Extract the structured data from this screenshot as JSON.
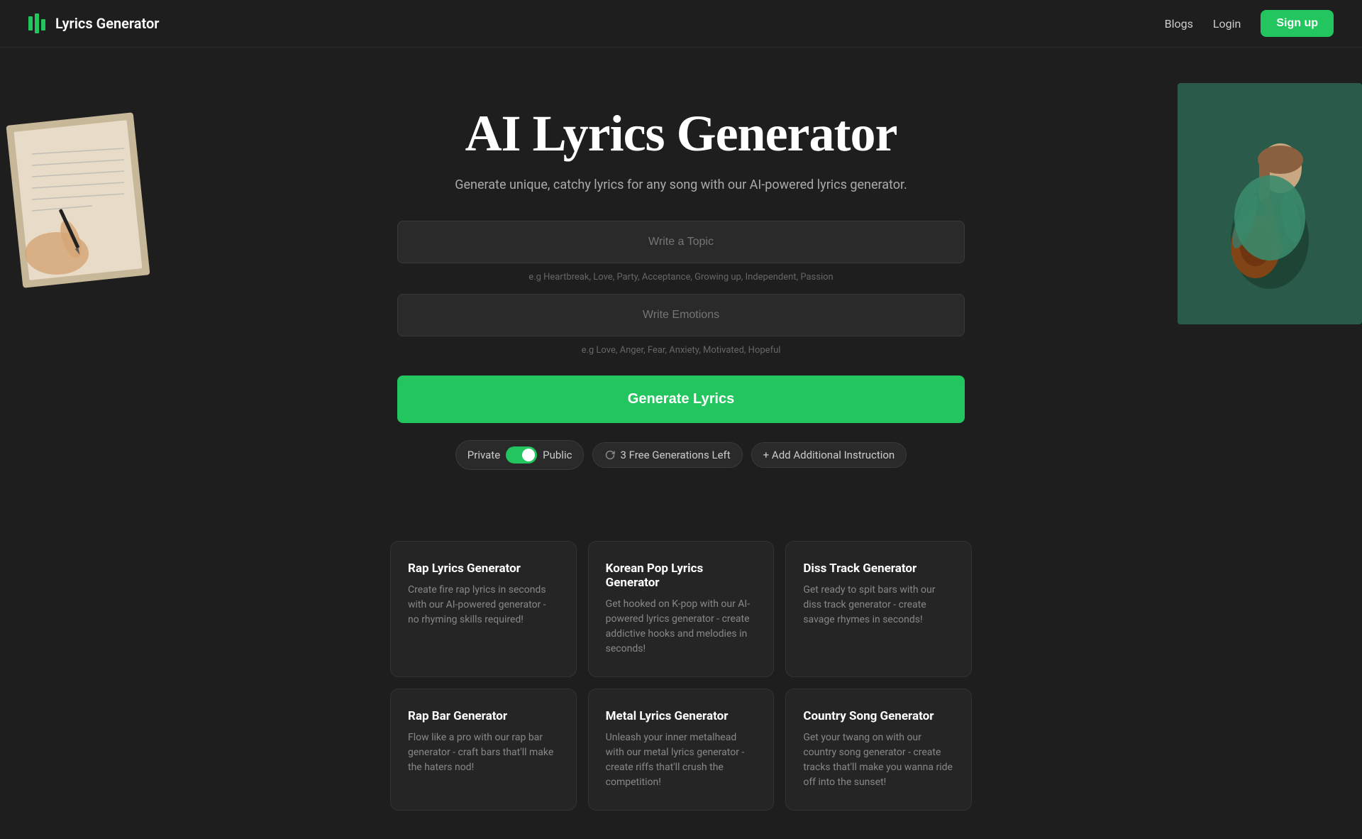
{
  "nav": {
    "logo_text": "Lyrics Generator",
    "blogs_label": "Blogs",
    "login_label": "Login",
    "signup_label": "Sign up"
  },
  "hero": {
    "title": "AI Lyrics Generator",
    "subtitle": "Generate unique, catchy lyrics for any song with our AI-powered lyrics generator."
  },
  "form": {
    "topic_placeholder": "Write a Topic",
    "topic_hint": "e.g Heartbreak, Love, Party, Acceptance, Growing up, Independent, Passion",
    "emotions_placeholder": "Write Emotions",
    "emotions_hint": "e.g Love, Anger, Fear, Anxiety, Motivated, Hopeful",
    "generate_label": "Generate Lyrics"
  },
  "controls": {
    "private_label": "Private",
    "public_label": "Public",
    "free_gen_label": "3 Free Generations Left",
    "add_instruction_label": "+ Add Additional Instruction"
  },
  "cards": [
    {
      "title": "Rap Lyrics Generator",
      "desc": "Create fire rap lyrics in seconds with our AI-powered generator - no rhyming skills required!"
    },
    {
      "title": "Korean Pop Lyrics Generator",
      "desc": "Get hooked on K-pop with our AI-powered lyrics generator - create addictive hooks and melodies in seconds!"
    },
    {
      "title": "Diss Track Generator",
      "desc": "Get ready to spit bars with our diss track generator - create savage rhymes in seconds!"
    },
    {
      "title": "Rap Bar Generator",
      "desc": "Flow like a pro with our rap bar generator - craft bars that'll make the haters nod!"
    },
    {
      "title": "Metal Lyrics Generator",
      "desc": "Unleash your inner metalhead with our metal lyrics generator - create riffs that'll crush the competition!"
    },
    {
      "title": "Country Song Generator",
      "desc": "Get your twang on with our country song generator - create tracks that'll make you wanna ride off into the sunset!"
    }
  ]
}
